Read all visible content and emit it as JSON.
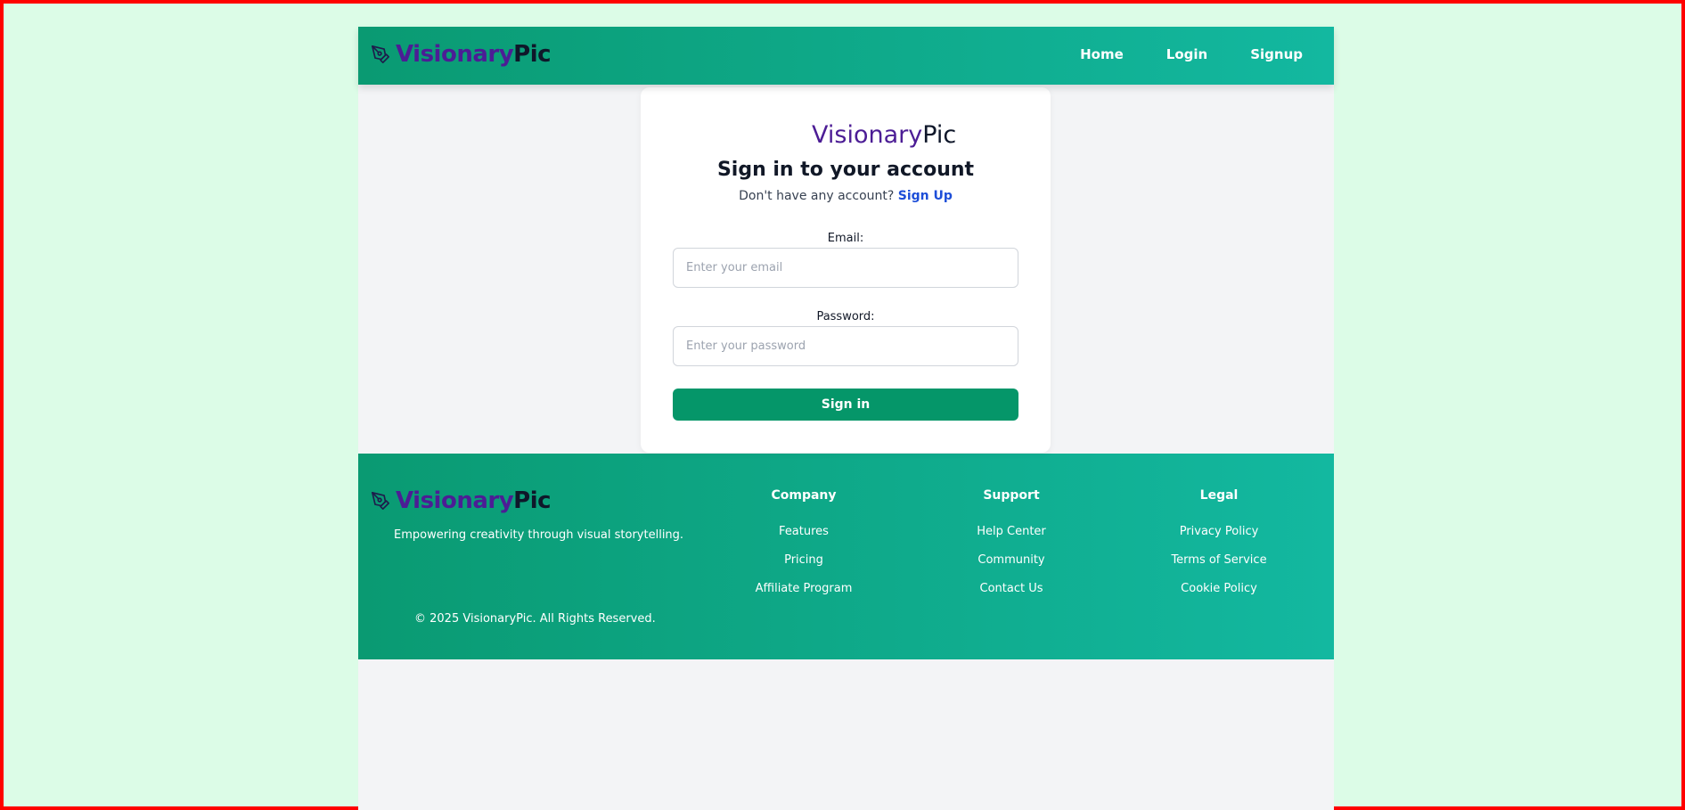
{
  "colors": {
    "page_bg": "#dcfce7",
    "border": "#ff0000",
    "header_gradient_start": "#0a9a72",
    "header_gradient_end": "#13b8a0",
    "brand_purple": "#4c1d95",
    "brand_dark": "#0f172a",
    "primary_button": "#059669",
    "link_blue": "#1d4ed8"
  },
  "navbar": {
    "brand_part1": "Visionary",
    "brand_part2": "Pic",
    "brand_icon": "pen-nib-icon",
    "links": [
      "Home",
      "Login",
      "Signup"
    ]
  },
  "card": {
    "brand_part1": "Visionary",
    "brand_part2": "Pic",
    "title": "Sign in to your account",
    "subtitle": "Don't have any account?",
    "signup_link": "Sign Up",
    "email_label": "Email:",
    "email_placeholder": "Enter your email",
    "email_value": "",
    "password_label": "Password:",
    "password_placeholder": "Enter your password",
    "password_value": "",
    "signin_button": "Sign in"
  },
  "footer": {
    "brand_part1": "Visionary",
    "brand_part2": "Pic",
    "brand_icon": "pen-nib-icon",
    "tagline": "Empowering creativity through visual storytelling.",
    "copyright": "© 2025 VisionaryPic. All Rights Reserved.",
    "columns": [
      {
        "heading": "Company",
        "links": [
          "Features",
          "Pricing",
          "Affiliate Program"
        ]
      },
      {
        "heading": "Support",
        "links": [
          "Help Center",
          "Community",
          "Contact Us"
        ]
      },
      {
        "heading": "Legal",
        "links": [
          "Privacy Policy",
          "Terms of Service",
          "Cookie Policy"
        ]
      }
    ]
  }
}
